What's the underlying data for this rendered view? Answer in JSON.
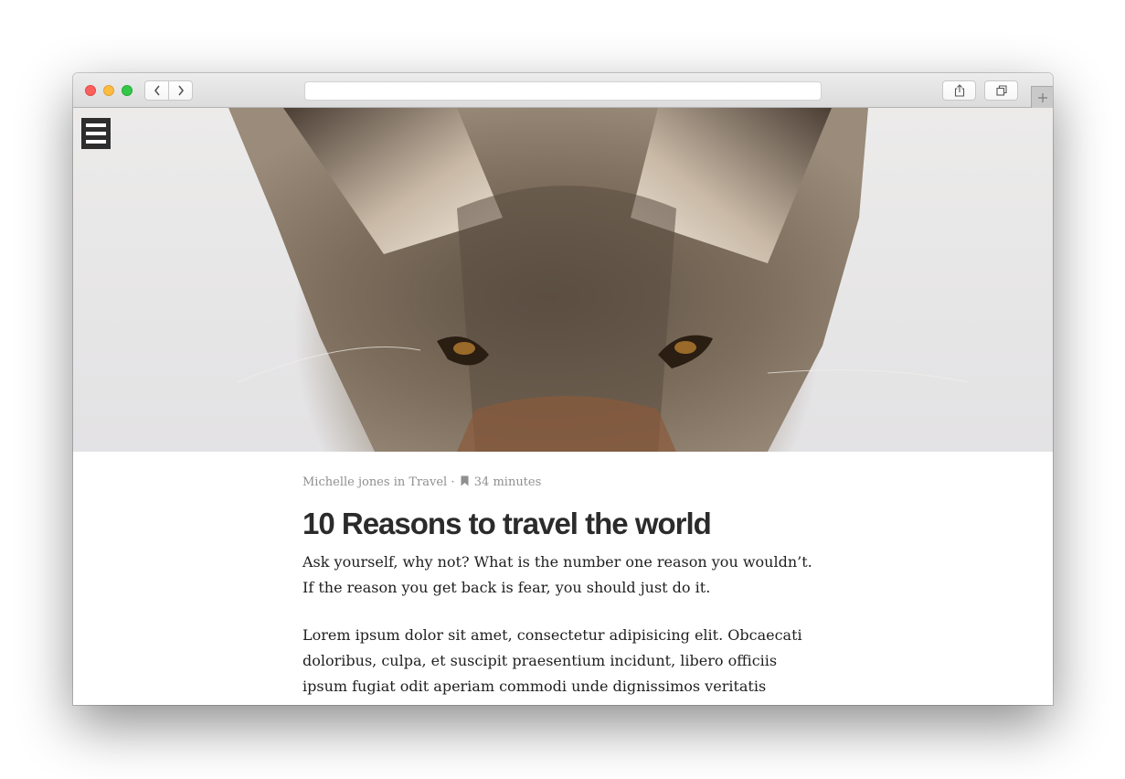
{
  "browser": {
    "address_text": "",
    "controls": {
      "back_icon": "chevron-left-icon",
      "forward_icon": "chevron-right-icon",
      "share_icon": "share-icon",
      "tabs_icon": "tabs-overview-icon",
      "new_tab_icon": "plus-icon"
    },
    "traffic_lights": {
      "close": "#fc605c",
      "minimize": "#fdbc40",
      "maximize": "#34c84a"
    }
  },
  "page": {
    "menu_icon": "hamburger-menu-icon",
    "hero_image": "coyote-closeup-photo",
    "meta": {
      "author": "Michelle jones",
      "in_word": "in",
      "category": "Travel",
      "separator": "·",
      "reading_icon": "bookmark-icon",
      "reading_time": "34 minutes"
    },
    "title": "10 Reasons to travel the world",
    "paragraphs": [
      "Ask yourself, why not? What is the number one reason you wouldn’t. If the reason you get back is fear, you should just do it.",
      "Lorem ipsum dolor sit amet, consectetur adipisicing elit. Obcaecati doloribus, culpa, et suscipit praesentium incidunt, libero officiis ipsum fugiat odit aperiam commodi unde dignissimos veritatis accusamus"
    ]
  }
}
